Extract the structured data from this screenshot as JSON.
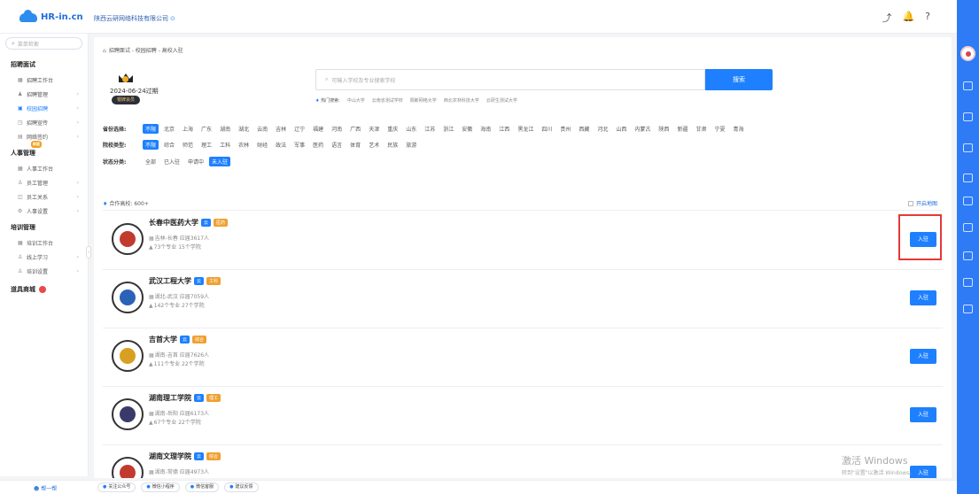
{
  "header": {
    "logo_text": "HR-in.cn",
    "company": "陕西云研网络科技有限公司",
    "company_marker": "⊙"
  },
  "sidebar": {
    "search_placeholder": "菜单检索",
    "sections": [
      {
        "title": "招聘面试",
        "items": [
          {
            "icon": "grid-icon",
            "label": "招聘工作台",
            "arrow": false,
            "active": false
          },
          {
            "icon": "people-icon",
            "label": "招聘管理",
            "arrow": true,
            "active": false
          },
          {
            "icon": "school-icon",
            "label": "校园招聘",
            "arrow": true,
            "active": true
          },
          {
            "icon": "megaphone-icon",
            "label": "招聘宣传",
            "arrow": true,
            "active": false
          },
          {
            "icon": "contract-icon",
            "label": "网络签约",
            "arrow": true,
            "active": false
          }
        ]
      },
      {
        "title": "人事管理",
        "badge": "新版",
        "items": [
          {
            "icon": "grid-icon",
            "label": "人事工作台",
            "arrow": false,
            "active": false
          },
          {
            "icon": "person-icon",
            "label": "员工管理",
            "arrow": true,
            "active": false
          },
          {
            "icon": "relation-icon",
            "label": "员工关系",
            "arrow": true,
            "active": false
          },
          {
            "icon": "settings-icon",
            "label": "人事设置",
            "arrow": true,
            "active": false
          }
        ]
      },
      {
        "title": "培训管理",
        "items": [
          {
            "icon": "grid-icon",
            "label": "培训工作台",
            "arrow": false,
            "active": false
          },
          {
            "icon": "person-icon",
            "label": "线上学习",
            "arrow": true,
            "active": false
          },
          {
            "icon": "person-icon",
            "label": "培训设置",
            "arrow": true,
            "active": false
          }
        ]
      }
    ],
    "mall": "道具商城"
  },
  "bottom": {
    "help": "帮一帮",
    "links": [
      "关注公众号",
      "微信小程序",
      "微信客服",
      "建议反馈"
    ]
  },
  "main": {
    "breadcrumb": "招聘面试 - 校园招聘 - 高校入驻",
    "member": {
      "date": "2024-06-24过期",
      "badge": "银牌会员"
    },
    "search": {
      "placeholder": "可输入学校及专业搜索学校",
      "button": "搜索"
    },
    "hot": {
      "label": "热门搜索:",
      "items": [
        "中山大学",
        "云南省测试学校",
        "隔断网络大学",
        "西北农林科技大学",
        "云研生测试大学"
      ]
    },
    "filters": [
      {
        "label": "省份选择:",
        "options": [
          "不限",
          "北京",
          "上海",
          "广东",
          "湖南",
          "湖北",
          "云南",
          "吉林",
          "辽宁",
          "福建",
          "河南",
          "广西",
          "天津",
          "重庆",
          "山东",
          "江苏",
          "浙江",
          "安徽",
          "海南",
          "江西",
          "黑龙江",
          "四川",
          "贵州",
          "西藏",
          "河北",
          "山西",
          "内蒙古",
          "陕西",
          "新疆",
          "甘肃",
          "宁夏",
          "青海"
        ],
        "selected": 0
      },
      {
        "label": "院校类型:",
        "options": [
          "不限",
          "综合",
          "师范",
          "理工",
          "工科",
          "农林",
          "财经",
          "政法",
          "军事",
          "医药",
          "语言",
          "体育",
          "艺术",
          "民族",
          "旅游"
        ],
        "selected": 0
      },
      {
        "label": "状态分类:",
        "options": [
          "全部",
          "已入驻",
          "申请中",
          "未入驻"
        ],
        "selected": 3
      }
    ],
    "coop_label": "合作高校: 600+",
    "map_toggle": "开启地图",
    "schools": [
      {
        "name": "长春中医药大学",
        "tags": [
          "云",
          "医药"
        ],
        "location": "吉林-长春",
        "grads": "应届3617人",
        "majors": "73个专业",
        "colleges": "15个学院",
        "button": "入驻",
        "color": "#c23a2e"
      },
      {
        "name": "武汉工程大学",
        "tags": [
          "云",
          "工科"
        ],
        "location": "湖北-武汉",
        "grads": "应届7059人",
        "majors": "142个专业",
        "colleges": "27个学院",
        "button": "入驻",
        "color": "#2a62b8"
      },
      {
        "name": "吉首大学",
        "tags": [
          "云",
          "综合"
        ],
        "location": "湖南-吉首",
        "grads": "应届7626人",
        "majors": "111个专业",
        "colleges": "22个学院",
        "button": "入驻",
        "color": "#d8a020"
      },
      {
        "name": "湖南理工学院",
        "tags": [
          "云",
          "理工"
        ],
        "location": "湖南-岳阳",
        "grads": "应届6173人",
        "majors": "67个专业",
        "colleges": "22个学院",
        "button": "入驻",
        "color": "#3a3a6a"
      },
      {
        "name": "湖南文理学院",
        "tags": [
          "云",
          "综合"
        ],
        "location": "湖南-常德",
        "grads": "应届4973人",
        "majors": "",
        "colleges": "",
        "button": "入驻",
        "color": "#c23a2e"
      }
    ]
  },
  "watermark": {
    "line1": "激活 Windows",
    "line2": "转到\"设置\"以激活 Windows。"
  }
}
